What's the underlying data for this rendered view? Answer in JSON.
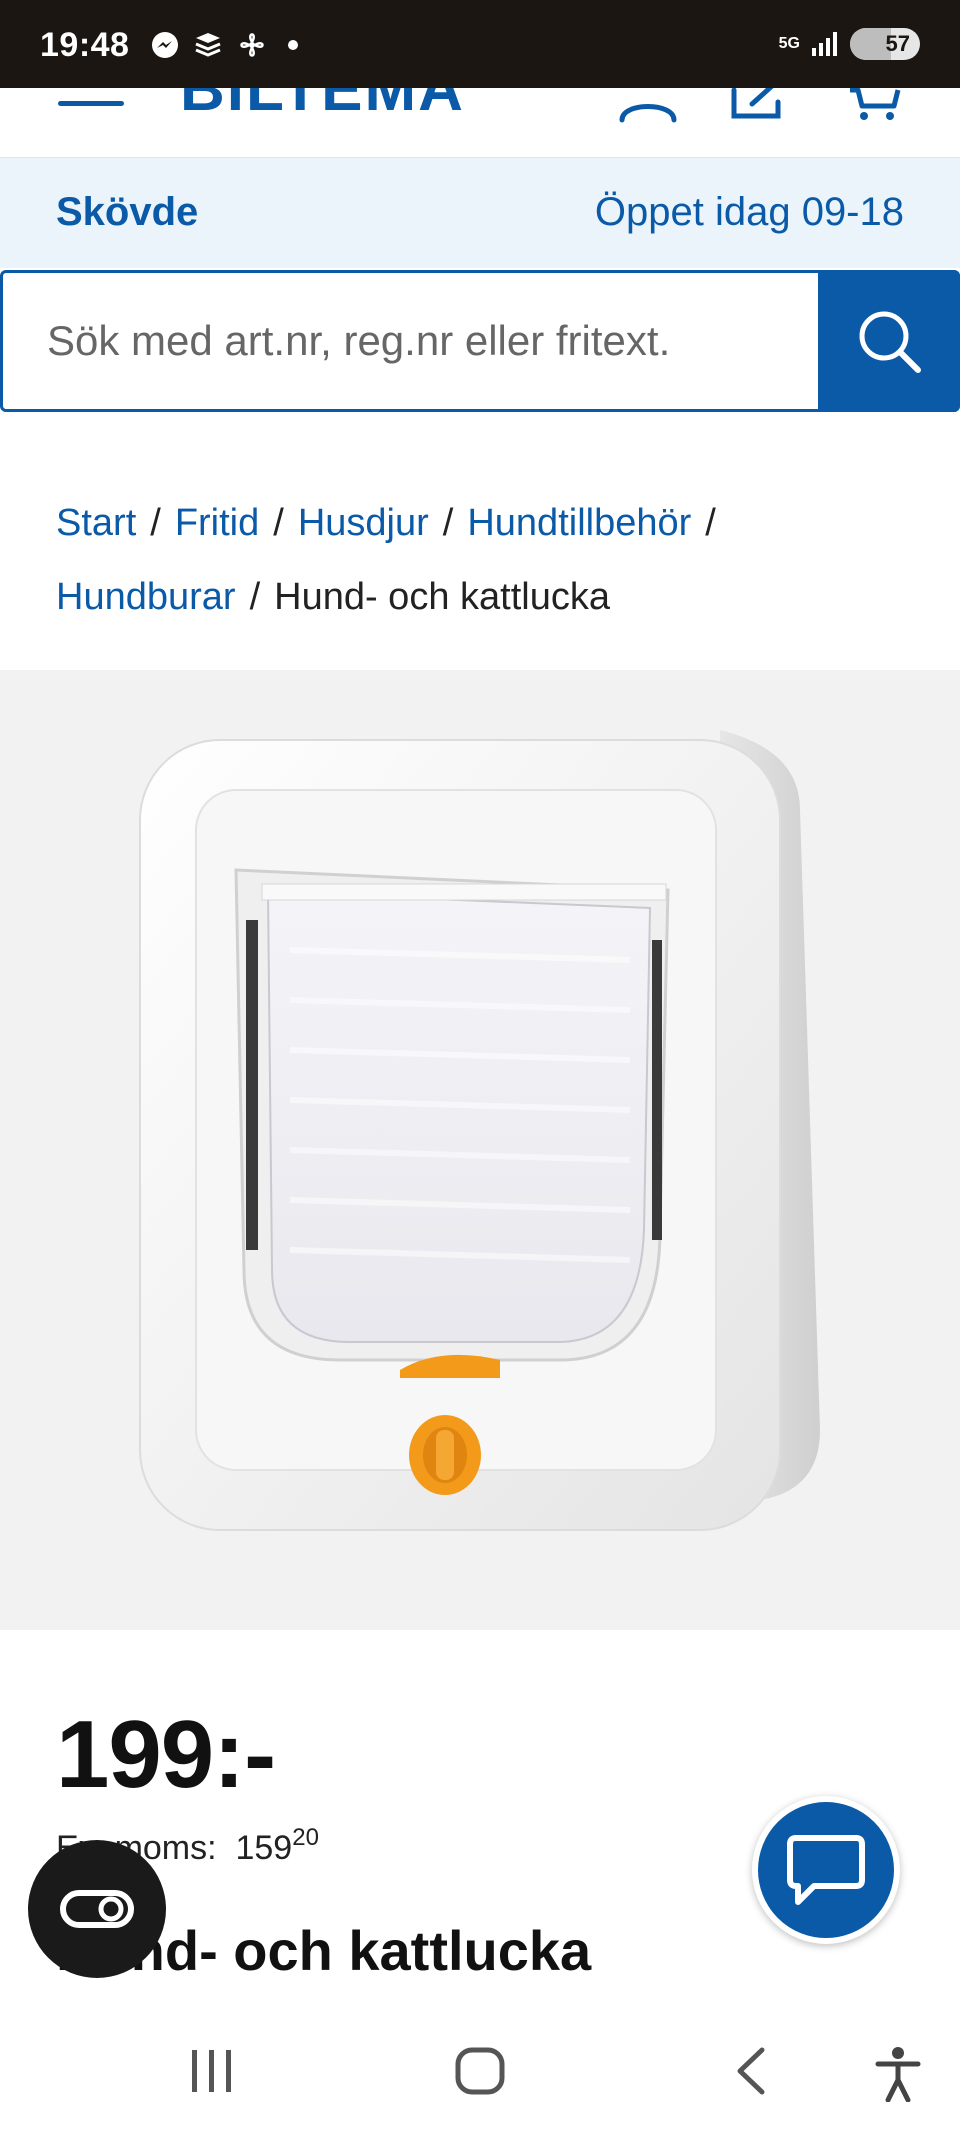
{
  "status_bar": {
    "time": "19:48",
    "network": "5G",
    "battery": "57"
  },
  "header": {
    "logo": "BILTEMA"
  },
  "store": {
    "name": "Skövde",
    "hours": "Öppet idag 09-18"
  },
  "search": {
    "placeholder": "Sök med art.nr, reg.nr eller fritext."
  },
  "breadcrumb": {
    "items": [
      "Start",
      "Fritid",
      "Husdjur",
      "Hundtillbehör",
      "Hundburar"
    ],
    "separator": "/",
    "current": "Hund- och kattlucka"
  },
  "product": {
    "price": "199:-",
    "ex_moms_label": "Ex. moms:",
    "ex_moms_value": "159",
    "ex_moms_cents": "20",
    "title": "Hund- och kattlucka"
  },
  "colors": {
    "brand_blue": "#0a5aa8",
    "store_bar_bg": "#eaf4fa",
    "accent_orange": "#f39a1b"
  },
  "icons": {
    "menu": "hamburger-icon",
    "account": "user-icon",
    "list": "edit-list-icon",
    "cart": "cart-icon",
    "search": "search-icon",
    "chat": "chat-icon",
    "accessibility_toggle": "accessibility-toggle-icon"
  }
}
